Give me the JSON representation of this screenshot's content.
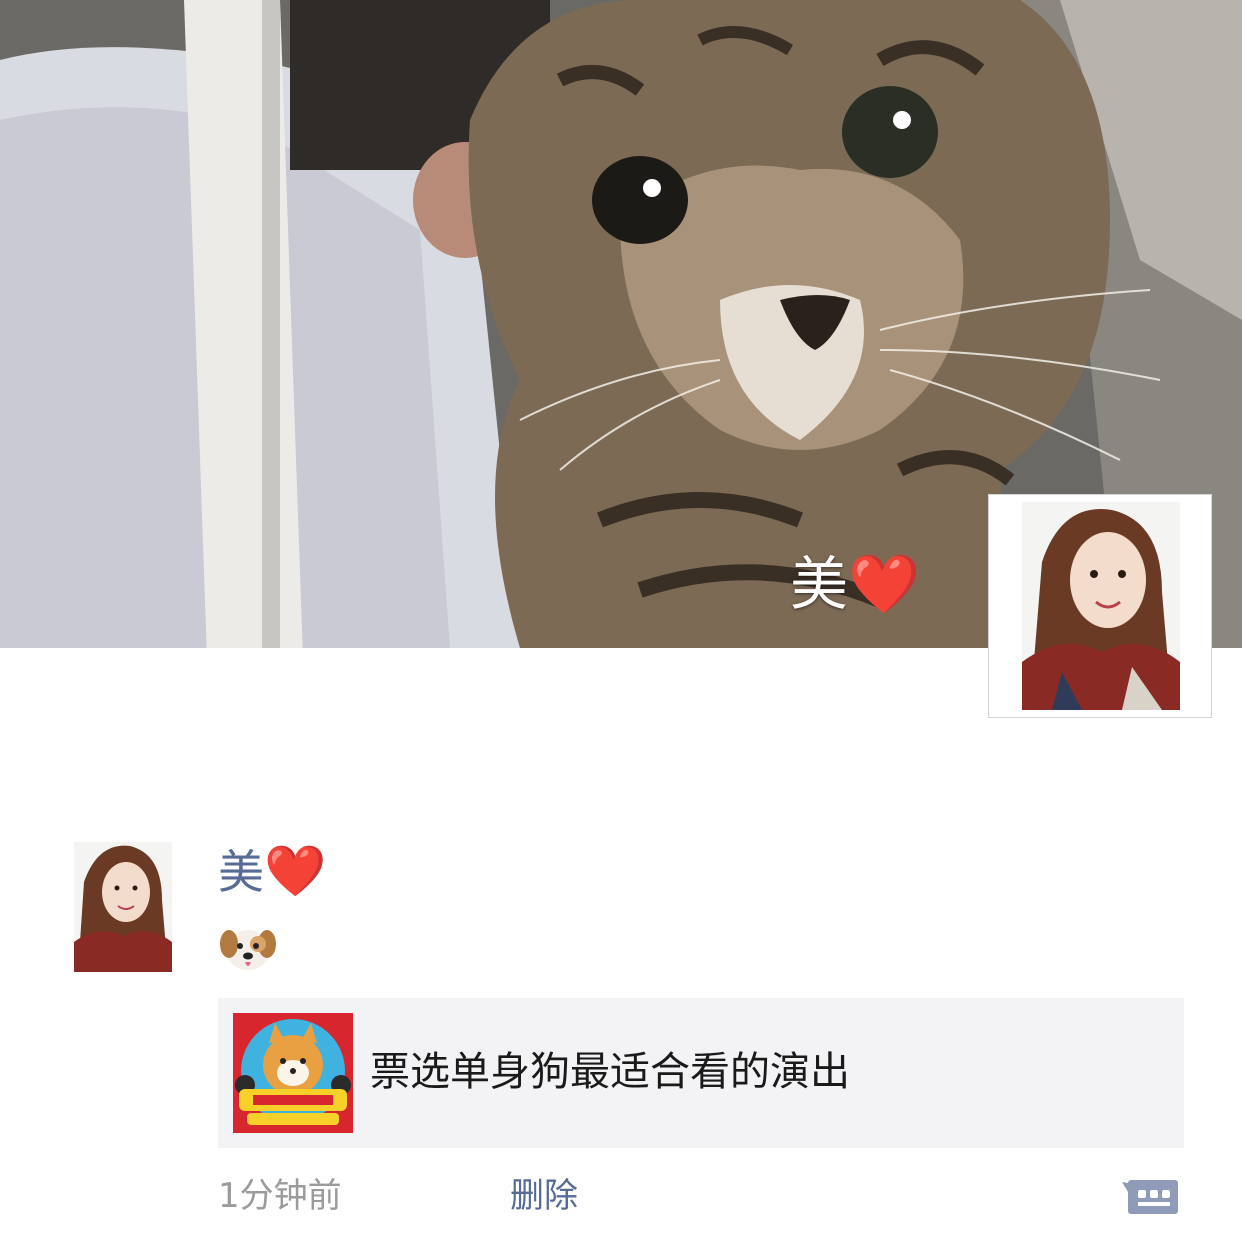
{
  "cover": {
    "name_text": "美",
    "heart": "❤️"
  },
  "post": {
    "author_text": "美",
    "author_heart": "❤️",
    "content_emoji": "dog-face-emoji",
    "share": {
      "title": "票选单身狗最适合看的演出",
      "thumb_icon": "shiba-dog-poster-icon"
    },
    "time": "1分钟前",
    "delete_label": "删除",
    "comment_icon": "comment-icon"
  },
  "colors": {
    "link": "#576b95",
    "time": "#9b9b9b",
    "card_bg": "#f3f3f5",
    "heart": "#e3262b"
  }
}
